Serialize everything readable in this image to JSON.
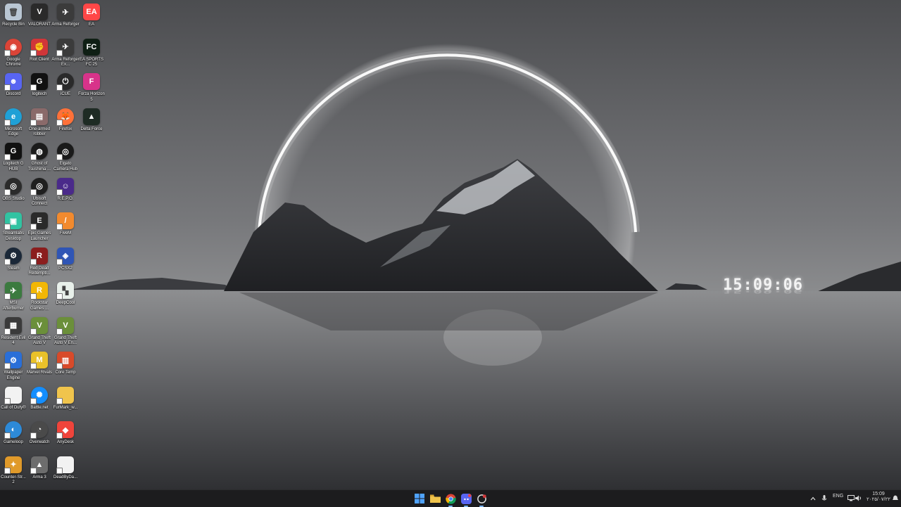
{
  "desktop": {
    "columns": [
      [
        {
          "label": "Recycle Bin",
          "icon": "recycle-bin-icon",
          "color": "#b9c6d3",
          "glyph": "🗑"
        },
        {
          "label": "Google Chrome",
          "icon": "chrome-icon",
          "color": "#db4437",
          "glyph": "◉"
        },
        {
          "label": "Discord",
          "icon": "discord-icon",
          "color": "#5865f2",
          "glyph": "☻"
        },
        {
          "label": "Microsoft Edge",
          "icon": "edge-icon",
          "color": "#1fa0d6",
          "glyph": "e"
        },
        {
          "label": "Logitech G HUB",
          "icon": "logitech-g-icon",
          "color": "#111111",
          "glyph": "G"
        },
        {
          "label": "OBS Studio",
          "icon": "obs-icon",
          "color": "#2b2b2b",
          "glyph": "◎"
        },
        {
          "label": "Streamlabs Desktop",
          "icon": "streamlabs-icon",
          "color": "#31c3a2",
          "glyph": "▣"
        },
        {
          "label": "Steam",
          "icon": "steam-icon",
          "color": "#1b2838",
          "glyph": "⚙"
        },
        {
          "label": "MSI Afterburner",
          "icon": "msi-afterburner-icon",
          "color": "#3b7a3f",
          "glyph": "✈"
        },
        {
          "label": "Resident Evil 4",
          "icon": "resident-evil-icon",
          "color": "#3a3a3a",
          "glyph": "▦"
        },
        {
          "label": "Wallpaper Engine",
          "icon": "wallpaper-engine-icon",
          "color": "#2a6fd8",
          "glyph": "⚙"
        },
        {
          "label": "Call of Duty®",
          "icon": "file-icon",
          "color": "#f2f2f2",
          "glyph": ""
        },
        {
          "label": "Gameloop",
          "icon": "gameloop-icon",
          "color": "#2d8ad8",
          "glyph": "◐"
        },
        {
          "label": "Counter-Str... 2",
          "icon": "counter-strike-icon",
          "color": "#e09a2a",
          "glyph": "✦"
        }
      ],
      [
        {
          "label": "VALORANT",
          "icon": "valorant-icon",
          "color": "#2a2a2a",
          "glyph": "V"
        },
        {
          "label": "Riot Client",
          "icon": "riot-client-icon",
          "color": "#d13639",
          "glyph": "✊"
        },
        {
          "label": "logitech",
          "icon": "logitech-icon",
          "color": "#111111",
          "glyph": "G"
        },
        {
          "label": "One-armed robber",
          "icon": "one-armed-robber-icon",
          "color": "#8a6a6a",
          "glyph": "▤"
        },
        {
          "label": "Ghost of Tsushima ...",
          "icon": "ghost-of-tsushima-icon",
          "color": "#1b1b1b",
          "glyph": "◍"
        },
        {
          "label": "Ubisoft Connect",
          "icon": "ubisoft-icon",
          "color": "#1f1f1f",
          "glyph": "◎"
        },
        {
          "label": "Epic Games Launcher",
          "icon": "epic-games-icon",
          "color": "#2a2a2a",
          "glyph": "E"
        },
        {
          "label": "Red Dead Redempti...",
          "icon": "red-dead-icon",
          "color": "#8b1d1d",
          "glyph": "R"
        },
        {
          "label": "Rockstar Games ...",
          "icon": "rockstar-icon",
          "color": "#f2b705",
          "glyph": "R"
        },
        {
          "label": "Grand Theft Auto V",
          "icon": "gta-v-icon",
          "color": "#6b8f3a",
          "glyph": "V"
        },
        {
          "label": "Marvel Rivals",
          "icon": "marvel-rivals-icon",
          "color": "#e9c12a",
          "glyph": "M"
        },
        {
          "label": "Battle.net",
          "icon": "battlenet-icon",
          "color": "#148eff",
          "glyph": "✺"
        },
        {
          "label": "Overwatch",
          "icon": "overwatch-icon",
          "color": "#4a4a4a",
          "glyph": "◔"
        },
        {
          "label": "Arma 3",
          "icon": "arma-3-icon",
          "color": "#6d6d6d",
          "glyph": "▲"
        }
      ],
      [
        {
          "label": "Arma Reforger",
          "icon": "arma-reforger-icon",
          "color": "#3b3b3b",
          "glyph": "✈"
        },
        {
          "label": "Arma Reforger Ex...",
          "icon": "arma-reforger-icon",
          "color": "#3b3b3b",
          "glyph": "✈"
        },
        {
          "label": "iCUE",
          "icon": "icue-icon",
          "color": "#2a2a2a",
          "glyph": "⏻"
        },
        {
          "label": "Firefox",
          "icon": "firefox-icon",
          "color": "#ff7139",
          "glyph": "🦊"
        },
        {
          "label": "Elgato Camera Hub",
          "icon": "elgato-icon",
          "color": "#1a1a1a",
          "glyph": "◎"
        },
        {
          "label": "R.E.P.O.",
          "icon": "repo-icon",
          "color": "#4a2a8a",
          "glyph": "☺"
        },
        {
          "label": "FiveM",
          "icon": "fivem-icon",
          "color": "#f28a2e",
          "glyph": "/"
        },
        {
          "label": "PCSX2",
          "icon": "pcsx2-icon",
          "color": "#2f55b5",
          "glyph": "◈"
        },
        {
          "label": "DeepCool",
          "icon": "deepcool-icon",
          "color": "#e8f0ea",
          "glyph": "▚"
        },
        {
          "label": "Grand Theft Auto V En...",
          "icon": "gta-v-icon",
          "color": "#6b8f3a",
          "glyph": "V"
        },
        {
          "label": "Core Temp",
          "icon": "core-temp-icon",
          "color": "#d84a2a",
          "glyph": "▥"
        },
        {
          "label": "FurMark_w...",
          "icon": "folder-icon",
          "color": "#f0c44c",
          "glyph": ""
        },
        {
          "label": "AnyDesk",
          "icon": "anydesk-icon",
          "color": "#ef443b",
          "glyph": "◆"
        },
        {
          "label": "DeadByDa...",
          "icon": "file-icon",
          "color": "#f2f2f2",
          "glyph": ""
        }
      ],
      [
        {
          "label": "EA",
          "icon": "ea-icon",
          "color": "#ff4747",
          "glyph": "EA"
        },
        {
          "label": "EA SPORTS FC 25",
          "icon": "ea-fc-icon",
          "color": "#0f1f14",
          "glyph": "FC"
        },
        {
          "label": "Forza Horizon 5",
          "icon": "forza-icon",
          "color": "#d8338a",
          "glyph": "F"
        },
        {
          "label": "Delta Force",
          "icon": "delta-force-icon",
          "color": "#1e2b24",
          "glyph": "▲"
        }
      ]
    ]
  },
  "clock": {
    "time": "15:09:06"
  },
  "taskbar": {
    "apps": [
      {
        "name": "start-button",
        "icon": "windows-start-icon",
        "color": "#4fa3ff"
      },
      {
        "name": "file-explorer-button",
        "icon": "folder-icon",
        "color": "#f0c44c"
      },
      {
        "name": "chrome-taskbar-button",
        "icon": "chrome-icon",
        "color": "#db4437"
      },
      {
        "name": "discord-taskbar-button",
        "icon": "discord-icon",
        "color": "#5865f2"
      },
      {
        "name": "riot-taskbar-button",
        "icon": "riot-client-icon",
        "color": "#d13639"
      }
    ],
    "tray": {
      "language": "ENG",
      "time": "15:09",
      "date": "۲۰۲۵/۰۷/۲۲"
    }
  }
}
